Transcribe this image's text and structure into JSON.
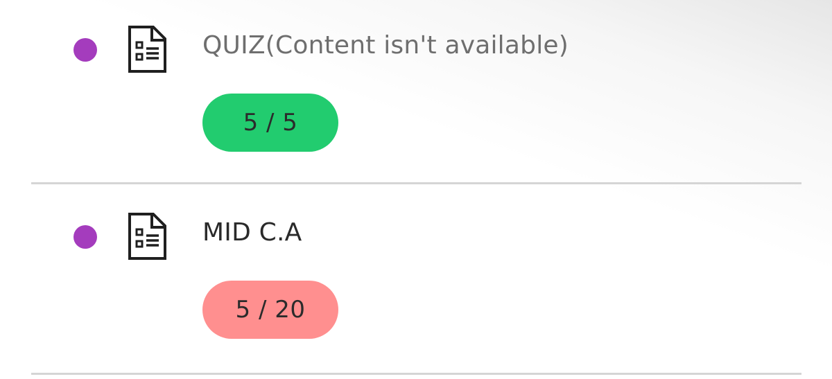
{
  "items": [
    {
      "bullet_color": "#a43cbd",
      "icon": "quiz-document-icon",
      "title": "QUIZ(Content isn't available)",
      "title_state": "unavailable",
      "score": "5 / 5",
      "score_color": "#22cc6f"
    },
    {
      "bullet_color": "#a43cbd",
      "icon": "quiz-document-icon",
      "title": "MID C.A",
      "title_state": "available",
      "score": "5 / 20",
      "score_color": "#ff8f8f"
    }
  ]
}
